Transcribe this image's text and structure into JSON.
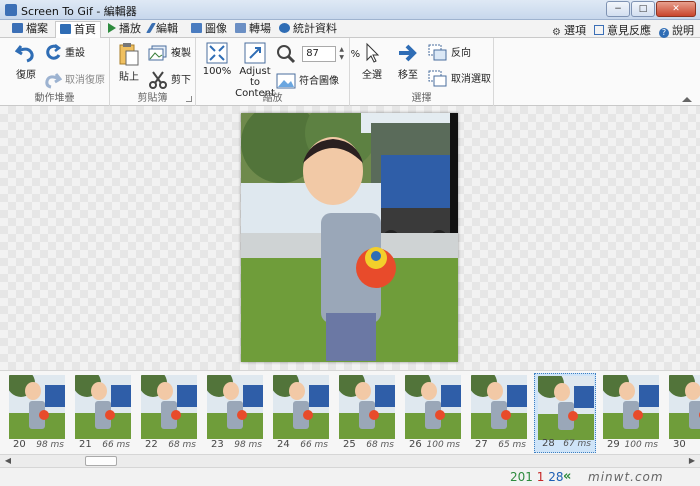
{
  "window": {
    "title": "Screen To Gif - 編輯器",
    "controls": {
      "minimize": "−",
      "maximize": "□",
      "close": "✕"
    }
  },
  "tabs": [
    {
      "label": "檔案",
      "icon": "save-icon",
      "color": "#3b6fb6"
    },
    {
      "label": "首頁",
      "icon": "home-icon",
      "color": "#2f6db5",
      "active": true
    },
    {
      "label": "播放",
      "icon": "play-icon",
      "color": "#2e8b3e"
    },
    {
      "label": "編輯",
      "icon": "pencil-icon",
      "color": "#3a6fb2"
    },
    {
      "label": "圖像",
      "icon": "image-icon",
      "color": "#4a7cc0"
    },
    {
      "label": "轉場",
      "icon": "transition-icon",
      "color": "#4a7cc0"
    },
    {
      "label": "統計資料",
      "icon": "info-icon",
      "color": "#2f6db5"
    }
  ],
  "header_links": {
    "options": "選項",
    "feedback": "意見反應",
    "help": "說明"
  },
  "ribbon": {
    "history": {
      "label": "動作堆疊",
      "undo": "復原",
      "reset": "重設",
      "redo": "取消復原"
    },
    "clipboard": {
      "label": "剪貼簿",
      "paste": "貼上",
      "copy": "複製",
      "cut": "剪下"
    },
    "zoom": {
      "label": "縮放",
      "zoom100": "100%",
      "adjust": "Adjust to Content",
      "value": "87",
      "unit": "%",
      "fit": "符合圖像"
    },
    "select": {
      "label": "選擇",
      "select_all": "全選",
      "goto": "移至",
      "inverse": "反向",
      "deselect": "取消選取"
    }
  },
  "frames": [
    {
      "n": "20",
      "d": "98 ms"
    },
    {
      "n": "21",
      "d": "66 ms"
    },
    {
      "n": "22",
      "d": "68 ms"
    },
    {
      "n": "23",
      "d": "98 ms"
    },
    {
      "n": "24",
      "d": "66 ms"
    },
    {
      "n": "25",
      "d": "68 ms"
    },
    {
      "n": "26",
      "d": "100 ms"
    },
    {
      "n": "27",
      "d": "65 ms"
    },
    {
      "n": "28",
      "d": "67 ms",
      "selected": true
    },
    {
      "n": "29",
      "d": "100 ms"
    },
    {
      "n": "30",
      "d": ""
    }
  ],
  "status": {
    "total": "201",
    "selected": "1",
    "current": "28",
    "total_color": "#2e8b3e",
    "selected_color": "#c62828",
    "current_color": "#1d5fb4"
  },
  "watermark": "minwt.com"
}
